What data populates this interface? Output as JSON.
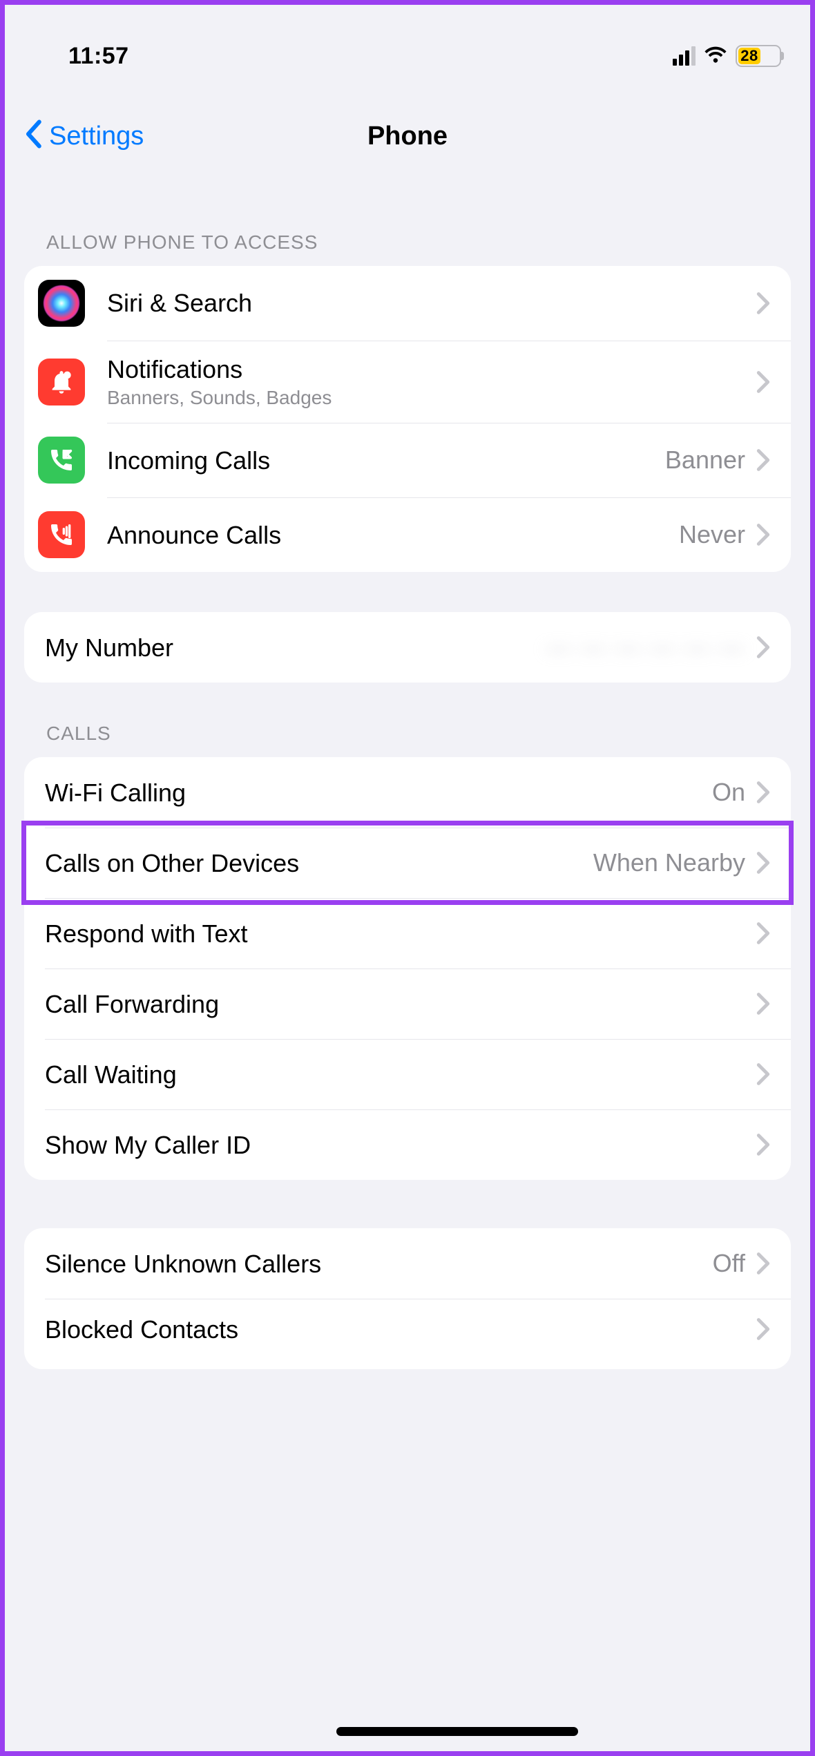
{
  "status": {
    "time": "11:57",
    "battery_pct": "28"
  },
  "nav": {
    "back_label": "Settings",
    "title": "Phone"
  },
  "sections": {
    "access": {
      "header": "ALLOW PHONE TO ACCESS",
      "items": [
        {
          "label": "Siri & Search"
        },
        {
          "label": "Notifications",
          "sub": "Banners, Sounds, Badges"
        },
        {
          "label": "Incoming Calls",
          "detail": "Banner"
        },
        {
          "label": "Announce Calls",
          "detail": "Never"
        }
      ]
    },
    "number": {
      "label": "My Number",
      "detail": "— — — — — —"
    },
    "calls": {
      "header": "CALLS",
      "items": [
        {
          "label": "Wi-Fi Calling",
          "detail": "On"
        },
        {
          "label": "Calls on Other Devices",
          "detail": "When Nearby"
        },
        {
          "label": "Respond with Text"
        },
        {
          "label": "Call Forwarding"
        },
        {
          "label": "Call Waiting"
        },
        {
          "label": "Show My Caller ID"
        }
      ]
    },
    "silence": {
      "items": [
        {
          "label": "Silence Unknown Callers",
          "detail": "Off"
        },
        {
          "label": "Blocked Contacts"
        }
      ]
    }
  }
}
